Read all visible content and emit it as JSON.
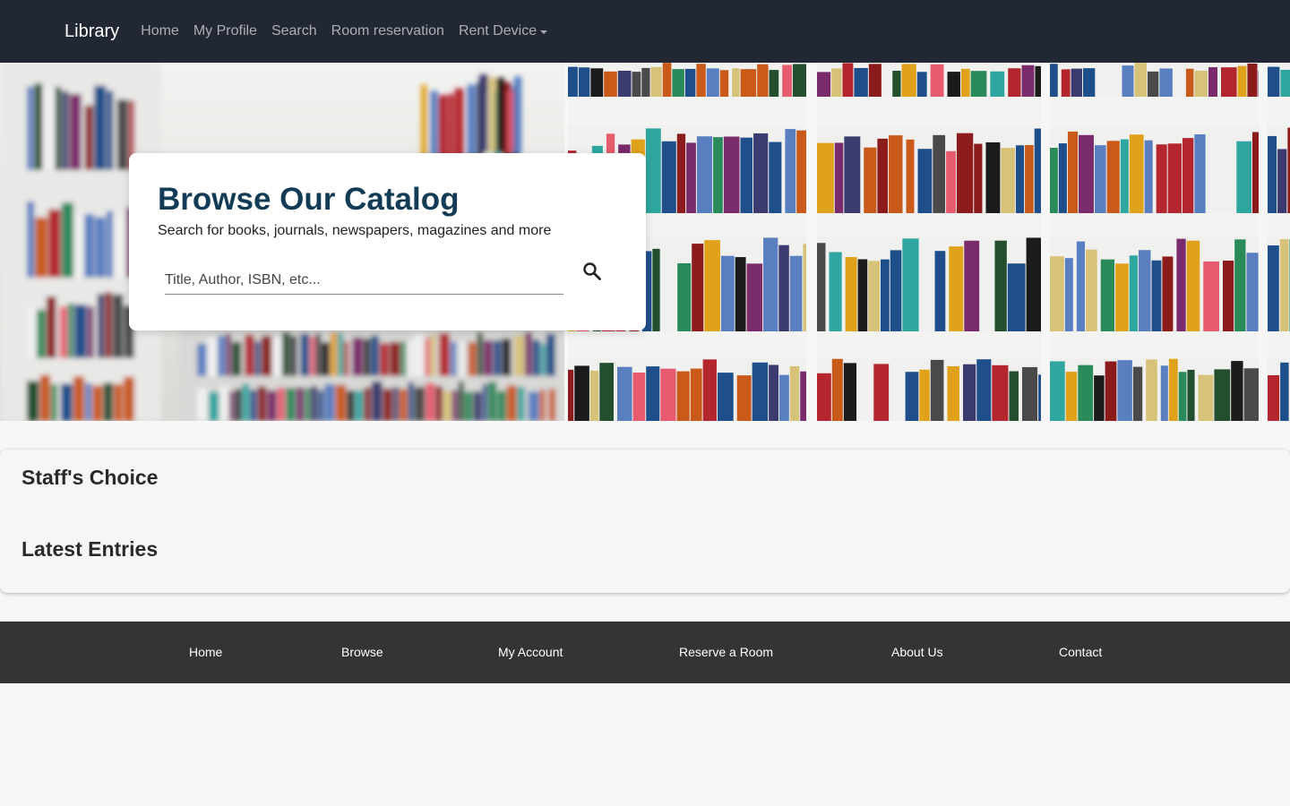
{
  "navbar": {
    "brand": "Library",
    "items": [
      "Home",
      "My Profile",
      "Search",
      "Room reservation",
      "Rent Device"
    ]
  },
  "hero": {
    "title": "Browse Our Catalog",
    "subtitle": "Search for books, journals, newspapers, magazines and more",
    "search_placeholder": "Title, Author, ISBN, etc..."
  },
  "sections": {
    "staff_choice": "Staff's Choice",
    "latest_entries": "Latest Entries"
  },
  "footer": {
    "links": [
      "Home",
      "Browse",
      "My Account",
      "Reserve a Room",
      "About Us",
      "Contact"
    ]
  },
  "colors": {
    "navbar_bg": "#212733",
    "title_color": "#123b55",
    "footer_bg": "#343434"
  }
}
